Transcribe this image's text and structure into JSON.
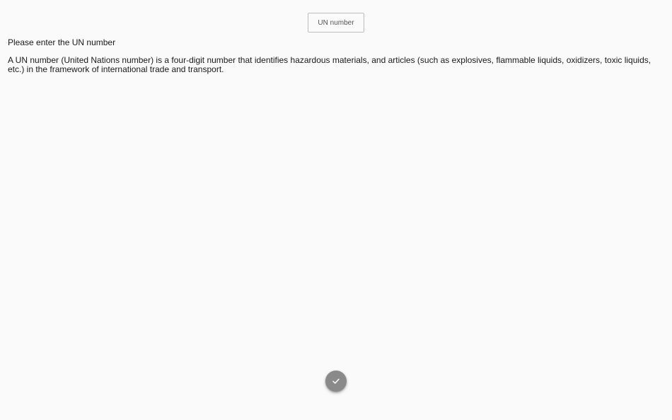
{
  "un_field": {
    "placeholder": "UN number",
    "value": ""
  },
  "prompt": "Please enter the UN number",
  "description": "A UN number (United Nations number) is a four-digit number that identifies hazardous materials, and articles (such as explosives, flammable liquids, oxidizers, toxic liquids, etc.) in the framework of international trade and transport.",
  "submit_button": {
    "icon": "check-icon",
    "color": "#8a8a8a"
  }
}
